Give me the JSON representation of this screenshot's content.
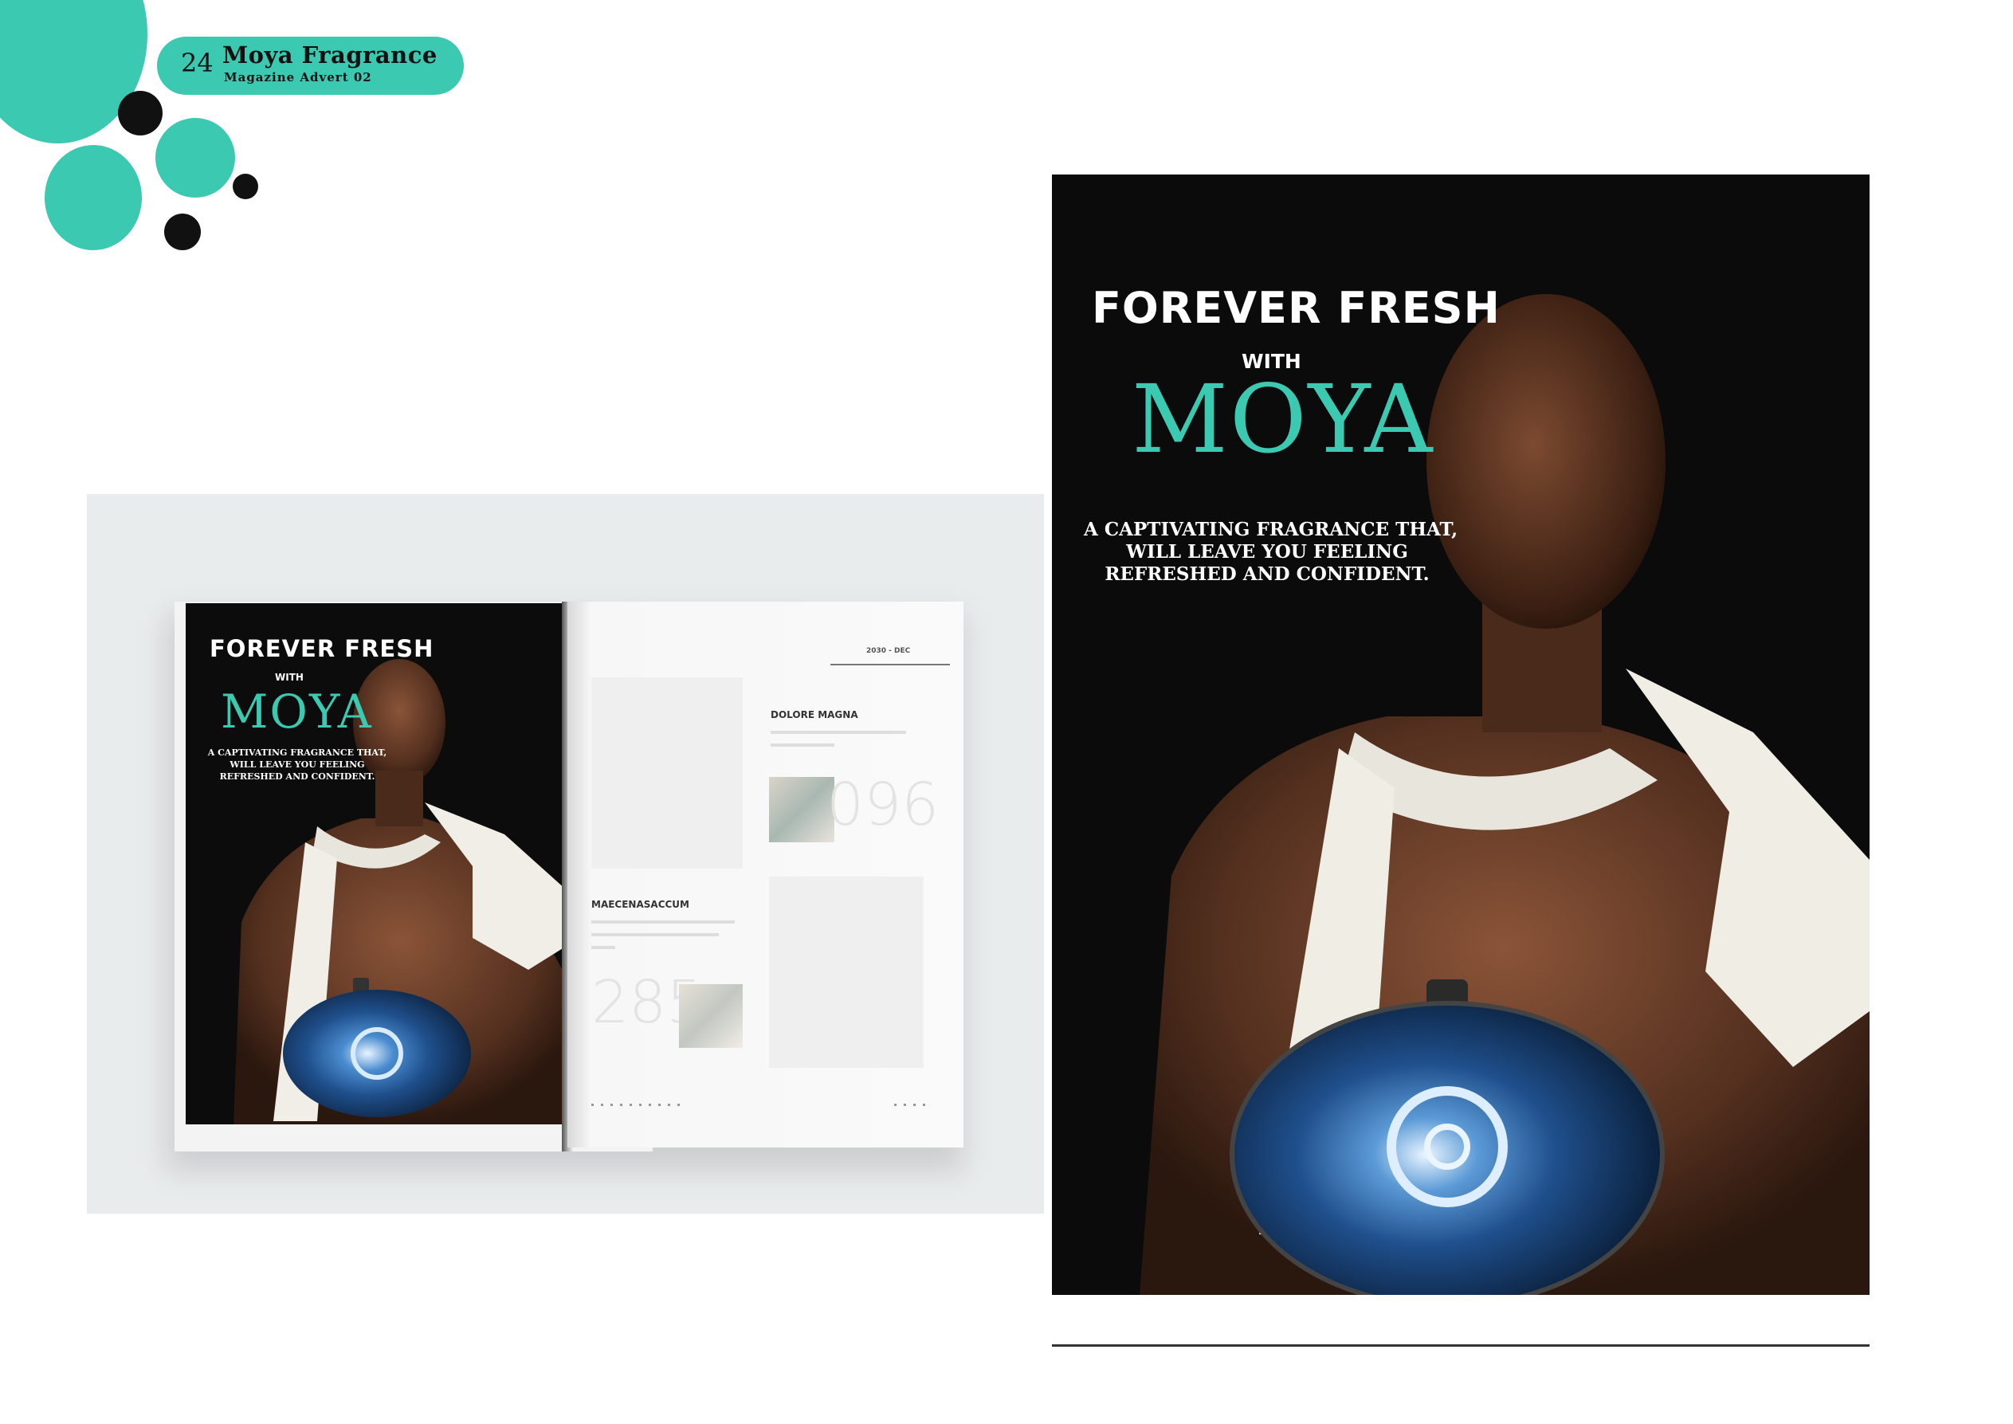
{
  "header": {
    "page_number": "24",
    "title": "Moya Fragrance",
    "subtitle": "Magazine Advert 02"
  },
  "colors": {
    "accent": "#3cc9b2",
    "dark": "#111111",
    "ad_background": "#0c0b0b"
  },
  "advert": {
    "headline": "FOREVER FRESH",
    "with": "WITH",
    "brand": "MOYA",
    "tagline_1": "A CAPTIVATING FRAGRANCE THAT,",
    "tagline_2": "WILL LEAVE YOU FEELING",
    "tagline_3": "REFRESHED AND CONFIDENT."
  },
  "magazine_right_page": {
    "date": "2030 - DEC",
    "heading_1": "DOLORE MAGNA",
    "number_1": "096",
    "heading_2": "MAECENASACCUM",
    "number_2": "285"
  },
  "icons": [
    "model-photo",
    "perfume-bottle-icon",
    "decor-circles"
  ]
}
